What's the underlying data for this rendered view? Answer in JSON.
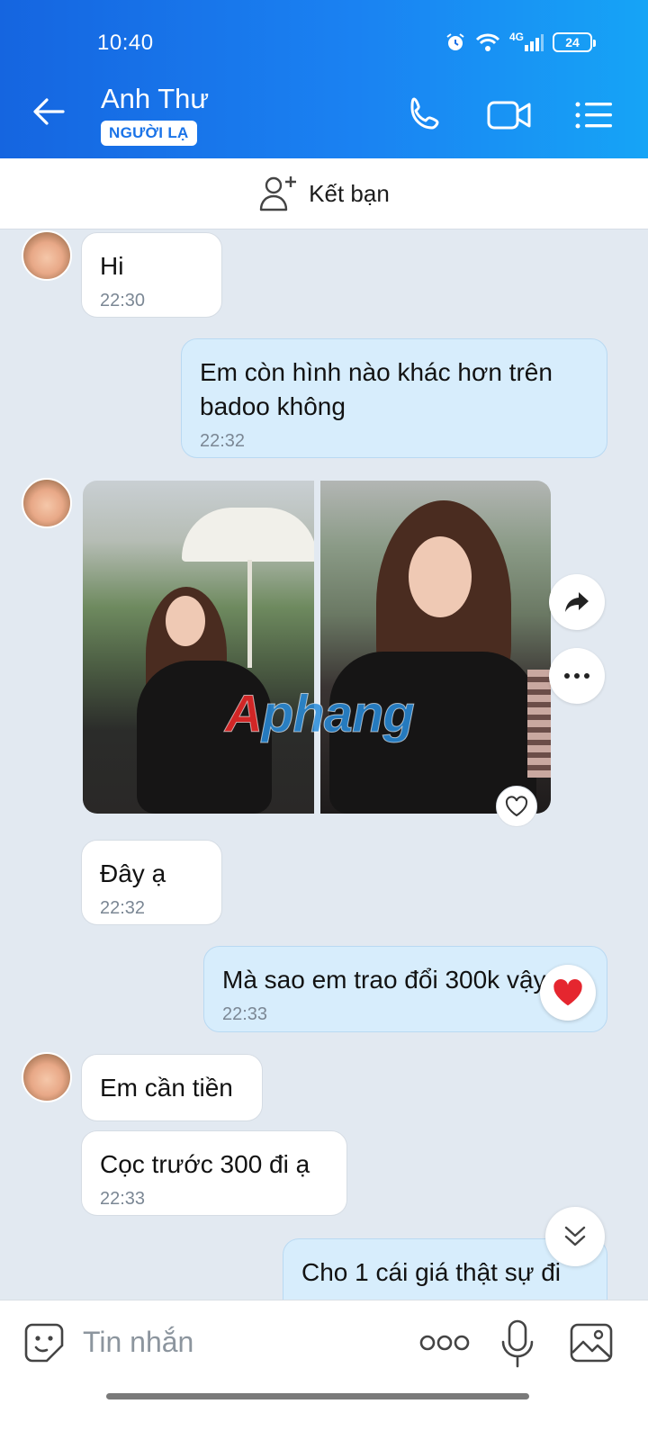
{
  "status_bar": {
    "time": "10:40",
    "network": "4G",
    "battery": "24"
  },
  "header": {
    "contact_name": "Anh Thư",
    "badge": "NGƯỜI LẠ"
  },
  "add_friend": {
    "label": "Kết bạn"
  },
  "messages": [
    {
      "side": "in",
      "text": "Hi",
      "time": "22:30"
    },
    {
      "side": "out",
      "text": "Em còn hình nào khác hơn trên badoo không",
      "time": "22:32"
    },
    {
      "side": "in",
      "type": "photos",
      "count": 2
    },
    {
      "side": "in",
      "text": "Đây ạ",
      "time": "22:32"
    },
    {
      "side": "out",
      "text": "Mà sao em trao đổi 300k vậy",
      "time": "22:33",
      "reaction": "heart"
    },
    {
      "side": "in",
      "text": "Em cần tiền"
    },
    {
      "side": "in",
      "text": "Cọc trước 300 đi ạ",
      "time": "22:33"
    },
    {
      "side": "out",
      "text": "Cho 1 cái giá thật sự đi"
    }
  ],
  "watermark": {
    "first": "A",
    "rest": "phang"
  },
  "composer": {
    "placeholder": "Tin nhắn"
  },
  "colors": {
    "header_start": "#1565e0",
    "header_end": "#16a4f6",
    "out_bubble": "#d7edfc",
    "in_bubble": "#ffffff",
    "chat_bg": "#e2e9f1"
  }
}
